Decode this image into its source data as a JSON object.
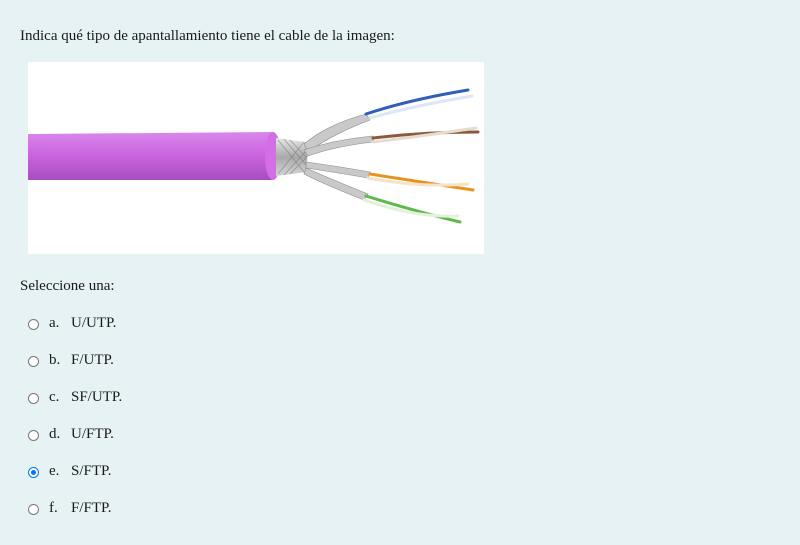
{
  "question": {
    "text": "Indica qué tipo de apantallamiento tiene el cable de la imagen:"
  },
  "image": {
    "subject": "cable-image",
    "jacket_color": "#cc66e0"
  },
  "prompt": {
    "text": "Seleccione una:"
  },
  "options": [
    {
      "letter": "a.",
      "label": "U/UTP.",
      "selected": false
    },
    {
      "letter": "b.",
      "label": "F/UTP.",
      "selected": false
    },
    {
      "letter": "c.",
      "label": "SF/UTP.",
      "selected": false
    },
    {
      "letter": "d.",
      "label": "U/FTP.",
      "selected": false
    },
    {
      "letter": "e.",
      "label": "S/FTP.",
      "selected": true
    },
    {
      "letter": "f.",
      "label": "F/FTP.",
      "selected": false
    }
  ],
  "colors": {
    "background": "#e7f2f5",
    "radio_checked": "#0075ff"
  }
}
